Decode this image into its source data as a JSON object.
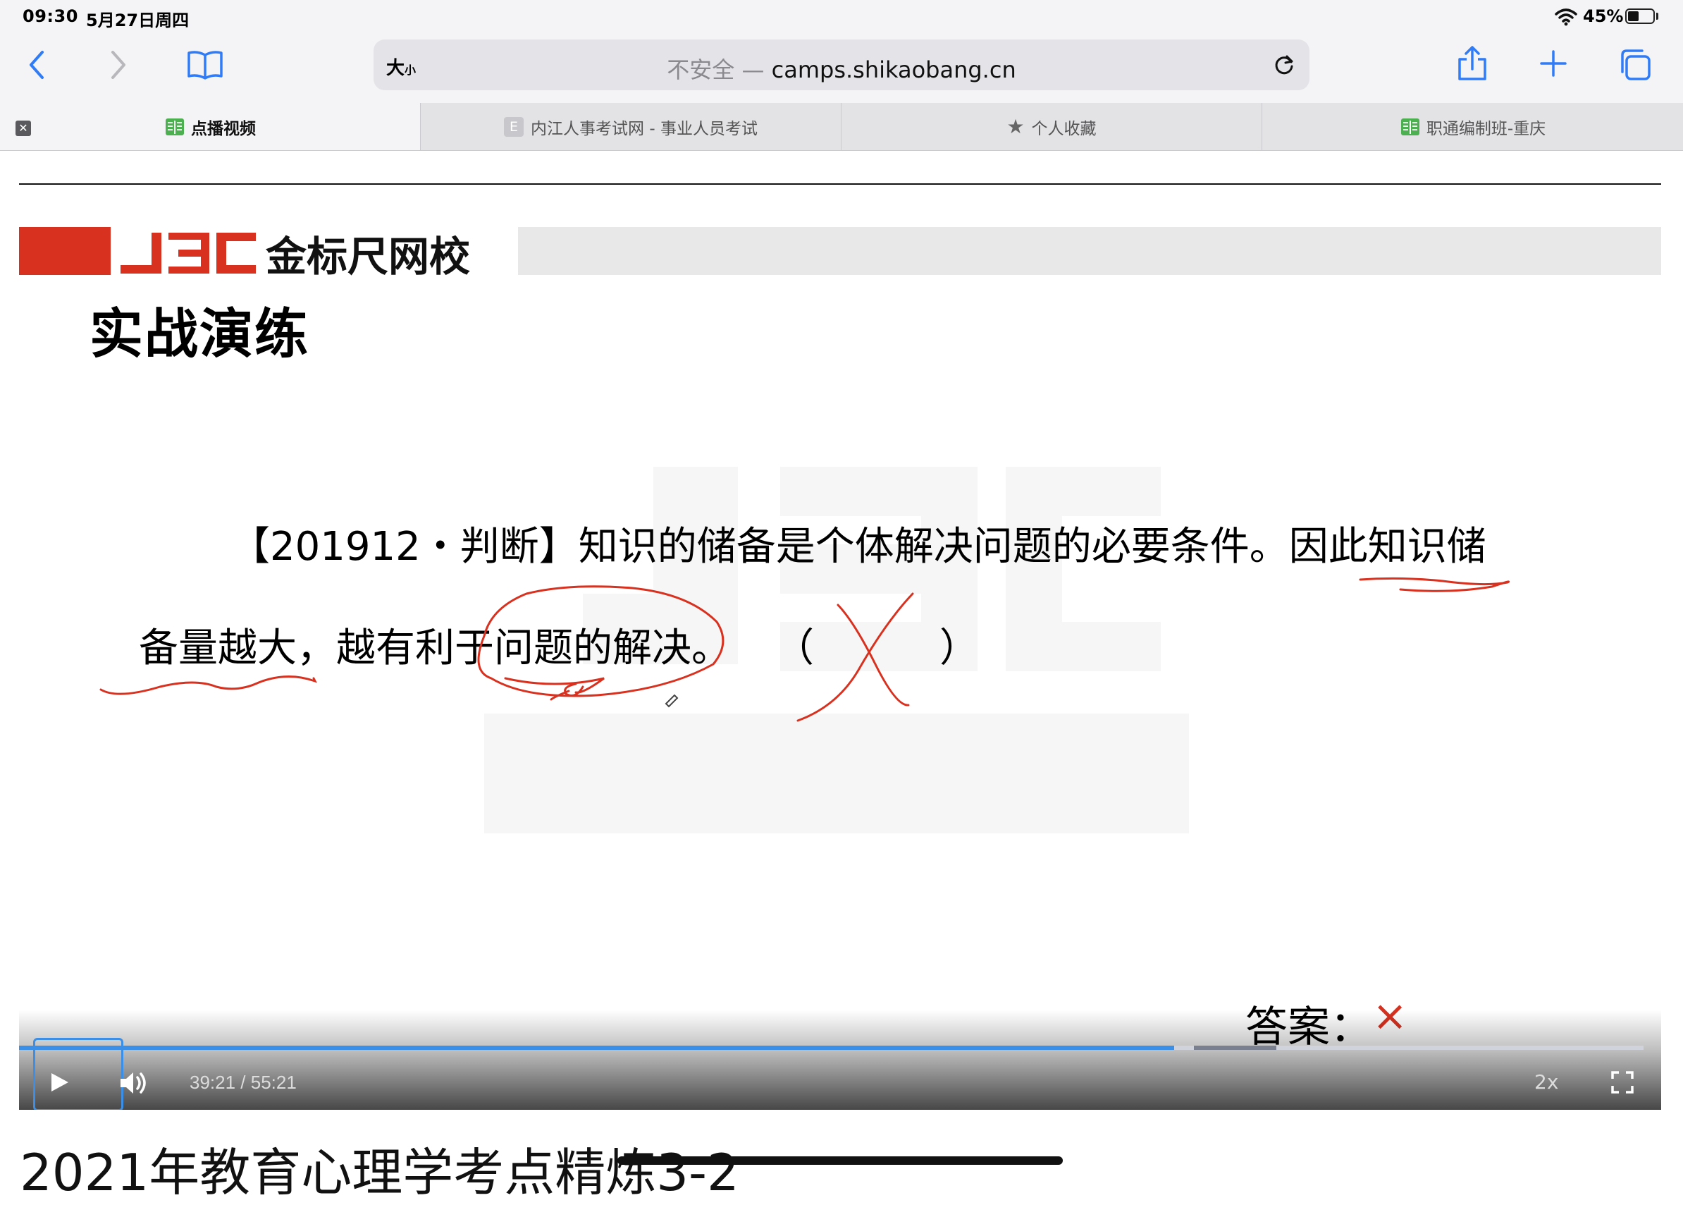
{
  "status_bar": {
    "time": "09:30",
    "date": "5月27日周四",
    "battery_pct": "45%",
    "battery_level": 0.45
  },
  "toolbar": {
    "text_size": "大",
    "text_size_small": "小",
    "address_insecure": "不安全 —",
    "address_domain": "camps.shikaobang.cn"
  },
  "tabs": [
    {
      "label": "点播视频",
      "icon": "book-tab-icon",
      "active": true
    },
    {
      "label": "内江人事考试网 - 事业人员考试",
      "icon": "E",
      "active": false
    },
    {
      "label": "个人收藏",
      "icon": "star-icon",
      "active": false
    },
    {
      "label": "职通编制班-重庆",
      "icon": "book-tab-icon",
      "active": false
    }
  ],
  "slide": {
    "brand_logo": "JBC金标尺网校",
    "title": "实战演练",
    "question_line1": "【201912・判断】知识的储备是个体解决问题的必要条件。因此知识储",
    "question_line2": "备量越大，越有利于问题的解决。",
    "question_paren": "（          ）",
    "answer_label": "答案：",
    "answer_mark": "×",
    "accent_color": "#d8311f"
  },
  "player": {
    "current_time": "39:21",
    "total_time": "55:21",
    "time_display": "39:21 / 55:21",
    "speed": "2x",
    "played_fraction": 0.711,
    "buffer_start_fraction": 0.723,
    "buffer_end_fraction": 0.774,
    "accent_color": "#3b8fe6"
  },
  "page": {
    "video_title": "2021年教育心理学考点精炼3-2"
  }
}
